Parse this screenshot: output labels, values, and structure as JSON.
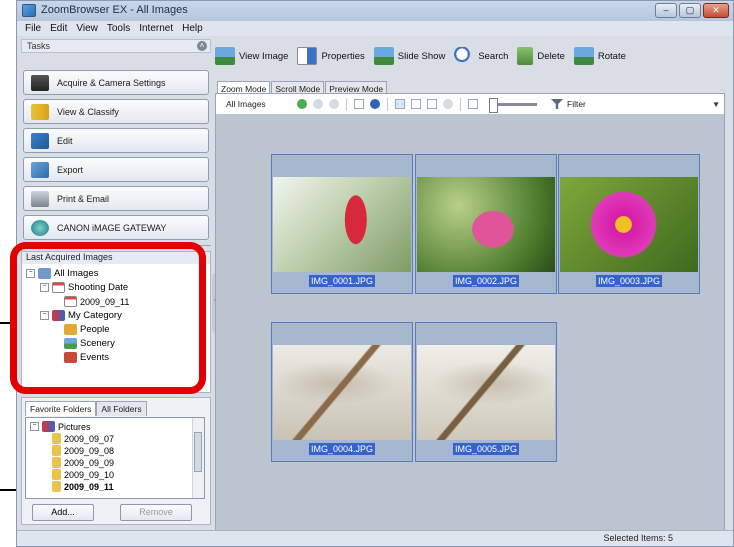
{
  "window": {
    "title": "ZoomBrowser EX - All Images",
    "controls": [
      "–",
      "▢",
      "✕"
    ]
  },
  "menu": [
    "File",
    "Edit",
    "View",
    "Tools",
    "Internet",
    "Help"
  ],
  "tasks": {
    "label": "Tasks",
    "buttons": [
      "Acquire & Camera Settings",
      "View & Classify",
      "Edit",
      "Export",
      "Print & Email",
      "CANON iMAGE GATEWAY"
    ]
  },
  "recent": {
    "label": "Last Acquired Images",
    "tree": {
      "all_images": "All Images",
      "shooting_date": "Shooting Date",
      "date_node": "2009_09_11",
      "my_category": "My Category",
      "people": "People",
      "scenery": "Scenery",
      "events": "Events"
    }
  },
  "folders": {
    "tabs": [
      "Favorite Folders",
      "All Folders"
    ],
    "root": "Pictures",
    "items": [
      "2009_09_07",
      "2009_09_08",
      "2009_09_09",
      "2009_09_10",
      "2009_09_11"
    ],
    "add_label": "Add...",
    "remove_label": "Remove"
  },
  "toolbar": [
    "View Image",
    "Properties",
    "Slide Show",
    "Search",
    "Delete",
    "Rotate"
  ],
  "view_tabs": [
    "Zoom Mode",
    "Scroll Mode",
    "Preview Mode"
  ],
  "viewbar": {
    "breadcrumb": "All Images",
    "filter_label": "Filter"
  },
  "images": [
    {
      "name": "IMG_0001.JPG",
      "subject": "red-flower-bud"
    },
    {
      "name": "IMG_0002.JPG",
      "subject": "pink-flower-bud"
    },
    {
      "name": "IMG_0003.JPG",
      "subject": "magenta-cosmos"
    },
    {
      "name": "IMG_0004.JPG",
      "subject": "dragonfly"
    },
    {
      "name": "IMG_0005.JPG",
      "subject": "dragonfly"
    }
  ],
  "status": {
    "selected": "Selected Items: 5"
  },
  "colors": {
    "selection": "#3563c8",
    "callout_box": "#e30000"
  }
}
